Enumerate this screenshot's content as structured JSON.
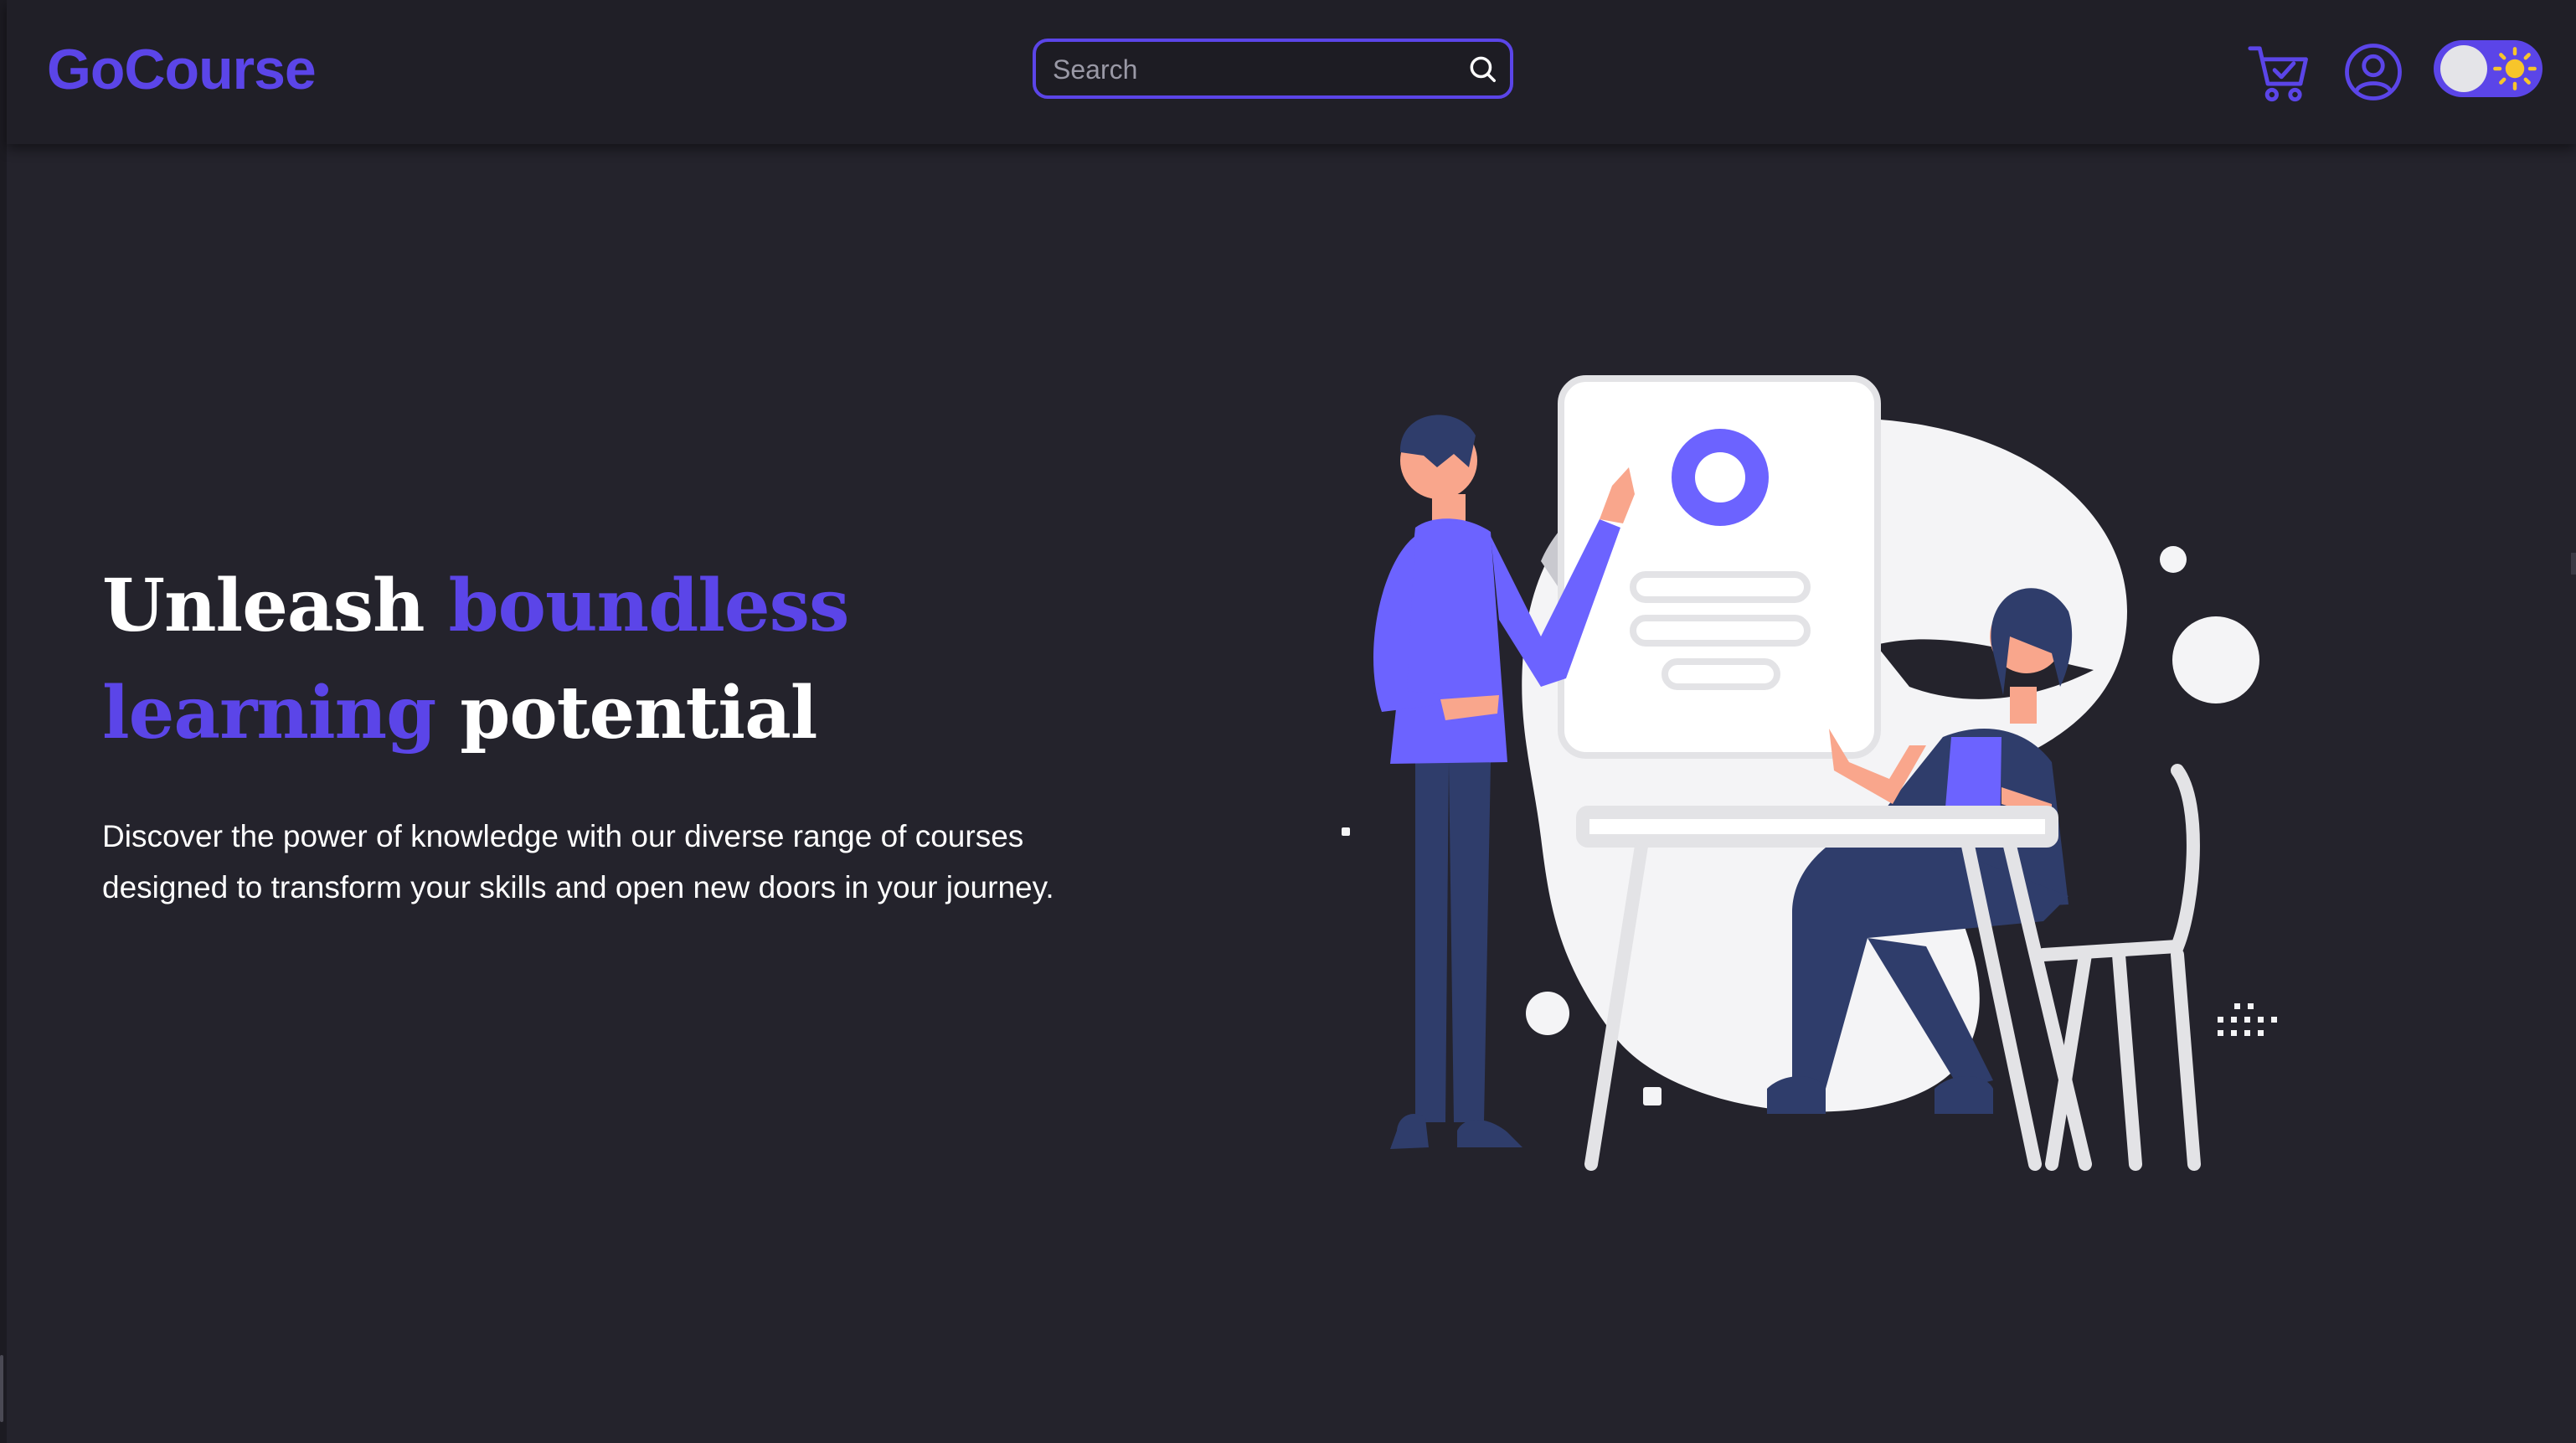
{
  "header": {
    "logo": "GoCourse",
    "search": {
      "placeholder": "Search",
      "value": ""
    },
    "icons": [
      "search-icon",
      "cart-icon",
      "user-icon",
      "sun-icon"
    ],
    "theme_toggle": {
      "state": "on"
    }
  },
  "hero": {
    "title_parts": [
      "Unleash ",
      "boundless",
      "learning",
      " potential"
    ],
    "description": "Discover the power of knowledge with our diverse range of courses designed to transform your skills and open new doors in your journey."
  },
  "colors": {
    "accent": "#5b45e8",
    "background": "#24232c",
    "header_bg": "#201f27",
    "text": "#ffffff",
    "illustration_purple": "#6c63ff",
    "illustration_navy": "#2f3d6b",
    "skin": "#f9a68c"
  }
}
